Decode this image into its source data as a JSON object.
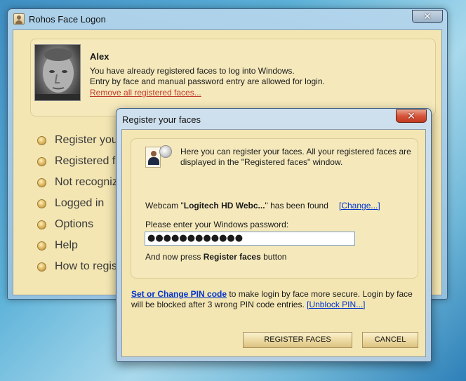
{
  "main_window": {
    "title": "Rohos Face Logon",
    "close_glyph": "✕",
    "user": {
      "name": "Alex",
      "info_lines": [
        "You have already registered faces to log into Windows.",
        "Entry by face and manual password entry are allowed for login."
      ],
      "remove_link": "Remove all registered faces..."
    },
    "nav_items": [
      "Register you",
      "Registered f",
      "Not recogniz",
      "Logged in",
      "Options",
      "Help",
      "How to regis"
    ]
  },
  "dialog": {
    "title": "Register your faces",
    "close_glyph": "✕",
    "intro_text": "Here you can register your faces. All your registered faces are displayed in the \"Registered faces\" window.",
    "webcam_prefix": "Webcam \"",
    "webcam_name": "Logitech HD Webc...",
    "webcam_suffix": "\" has been found",
    "change_link": "[Change...]",
    "password_label": "Please enter your Windows password:",
    "password_value": "●●●●●●●●●●●●",
    "press_prefix": "And now press ",
    "press_bold": "Register faces",
    "press_suffix": " button",
    "pin_link": "Set or Change PIN code",
    "pin_text": " to make login by face more secure. Login by face will be blocked after 3 wrong PIN code entries. ",
    "unblock_link": "[Unblock PIN...]",
    "register_button": "REGISTER FACES",
    "cancel_button": "CANCEL"
  },
  "colors": {
    "panel_bg": "#f3e6b3",
    "link_blue": "#0033cc",
    "link_red": "#c0392b",
    "close_red": "#c23c22"
  }
}
